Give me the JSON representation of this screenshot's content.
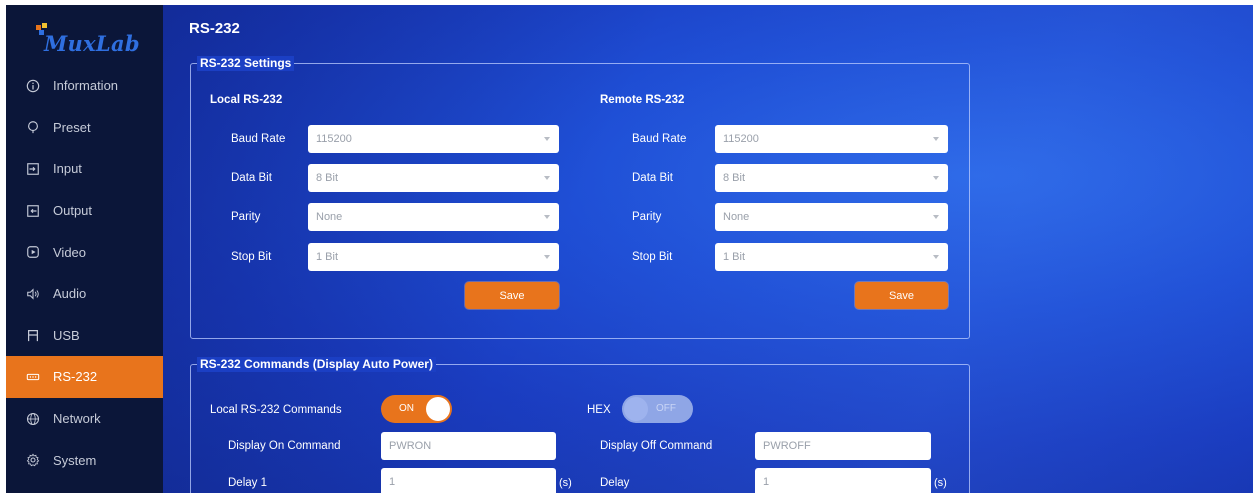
{
  "brand": {
    "logo_text": "MuxLab",
    "logo_colors": [
      "#e8741c",
      "#f2c230",
      "#2f6fe0"
    ]
  },
  "page": {
    "title": "RS-232"
  },
  "sidebar": {
    "items": [
      {
        "label": "Information",
        "icon": "info-circle-icon",
        "active": false
      },
      {
        "label": "Preset",
        "icon": "preset-icon",
        "active": false
      },
      {
        "label": "Input",
        "icon": "input-icon",
        "active": false
      },
      {
        "label": "Output",
        "icon": "output-icon",
        "active": false
      },
      {
        "label": "Video",
        "icon": "video-icon",
        "active": false
      },
      {
        "label": "Audio",
        "icon": "audio-icon",
        "active": false
      },
      {
        "label": "USB",
        "icon": "usb-icon",
        "active": false
      },
      {
        "label": "RS-232",
        "icon": "rs232-icon",
        "active": true
      },
      {
        "label": "Network",
        "icon": "globe-icon",
        "active": false
      },
      {
        "label": "System",
        "icon": "gear-icon",
        "active": false
      }
    ]
  },
  "settings": {
    "legend": "RS-232 Settings",
    "local": {
      "title": "Local RS-232",
      "baud_rate": {
        "label": "Baud Rate",
        "value": "115200"
      },
      "data_bit": {
        "label": "Data Bit",
        "value": "8 Bit"
      },
      "parity": {
        "label": "Parity",
        "value": "None"
      },
      "stop_bit": {
        "label": "Stop Bit",
        "value": "1 Bit"
      },
      "save_label": "Save"
    },
    "remote": {
      "title": "Remote RS-232",
      "baud_rate": {
        "label": "Baud Rate",
        "value": "115200"
      },
      "data_bit": {
        "label": "Data Bit",
        "value": "8 Bit"
      },
      "parity": {
        "label": "Parity",
        "value": "None"
      },
      "stop_bit": {
        "label": "Stop Bit",
        "value": "1 Bit"
      },
      "save_label": "Save"
    }
  },
  "commands": {
    "legend": "RS-232 Commands (Display Auto Power)",
    "local_commands": {
      "label": "Local RS-232 Commands",
      "state": "ON"
    },
    "hex": {
      "label": "HEX",
      "state": "OFF"
    },
    "display_on": {
      "label": "Display On Command",
      "value": "PWRON"
    },
    "display_off": {
      "label": "Display Off Command",
      "value": "PWROFF"
    },
    "delay1": {
      "label": "Delay 1",
      "value": "1",
      "unit": "(s)"
    },
    "delay": {
      "label": "Delay",
      "value": "1",
      "unit": "(s)"
    }
  },
  "colors": {
    "accent": "#e8741c",
    "sidebar_bg": "#0b1639",
    "background": "#1f4fd6"
  }
}
